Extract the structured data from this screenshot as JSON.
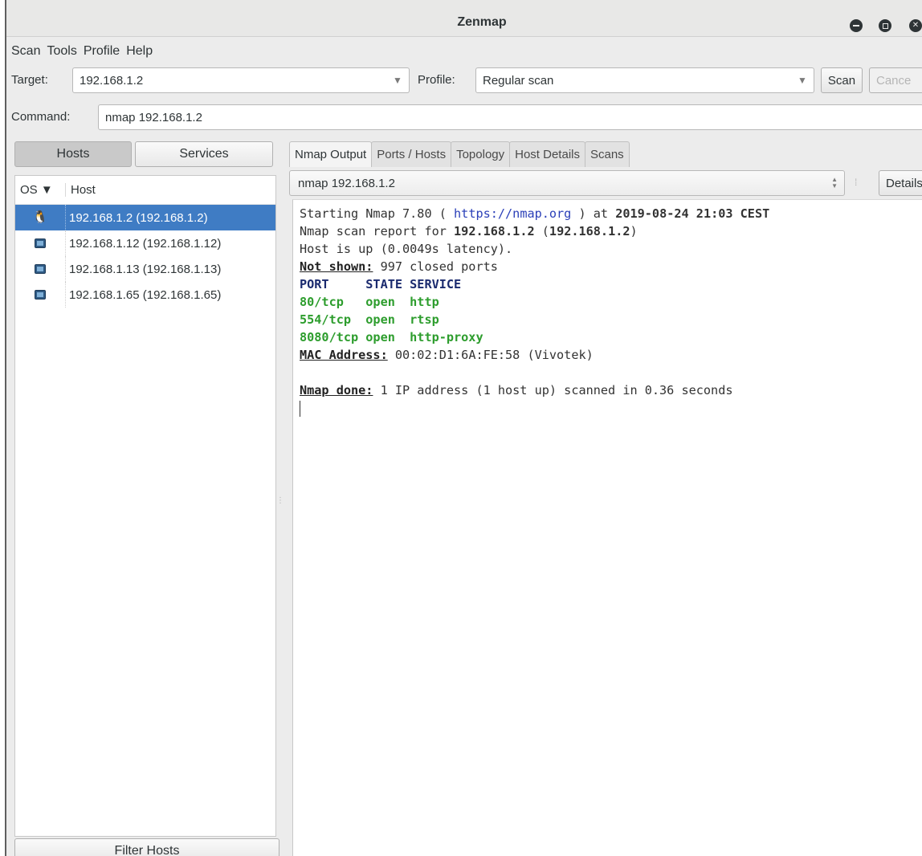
{
  "window": {
    "title": "Zenmap"
  },
  "menu": [
    "Scan",
    "Tools",
    "Profile",
    "Help"
  ],
  "toolbar": {
    "target_label": "Target:",
    "target_value": "192.168.1.2",
    "profile_label": "Profile:",
    "profile_value": "Regular scan",
    "scan_label": "Scan",
    "cancel_label": "Cance"
  },
  "command": {
    "label": "Command:",
    "value": "nmap 192.168.1.2"
  },
  "left_panel": {
    "tabs": [
      "Hosts",
      "Services"
    ],
    "columns": {
      "os": "OS ▼",
      "host": "Host"
    },
    "hosts": [
      {
        "os": "linux",
        "name": "192.168.1.2 (192.168.1.2)",
        "selected": true
      },
      {
        "os": "unknown",
        "name": "192.168.1.12 (192.168.1.12)",
        "selected": false
      },
      {
        "os": "unknown",
        "name": "192.168.1.13 (192.168.1.13)",
        "selected": false
      },
      {
        "os": "unknown",
        "name": "192.168.1.65 (192.168.1.65)",
        "selected": false
      }
    ],
    "filter_label": "Filter Hosts"
  },
  "right_panel": {
    "tabs": [
      "Nmap Output",
      "Ports / Hosts",
      "Topology",
      "Host Details",
      "Scans"
    ],
    "scan_select": "nmap 192.168.1.2",
    "details_label": "Details",
    "output": {
      "l1_a": "Starting Nmap 7.80 ( ",
      "l1_url": "https://nmap.org",
      "l1_b": " ) at ",
      "l1_date": "2019-08-24 21:03 CEST",
      "l2_a": "Nmap scan report for ",
      "l2_b": "192.168.1.2",
      "l2_c": " (",
      "l2_d": "192.168.1.2",
      "l2_e": ")",
      "l3": "Host is up (0.0049s latency).",
      "l4_key": "Not shown:",
      "l4_val": " 997 closed ports",
      "header": "PORT     STATE SERVICE",
      "ports": [
        "80/tcp   open  http",
        "554/tcp  open  rtsp",
        "8080/tcp open  http-proxy"
      ],
      "mac_key": "MAC Address:",
      "mac_val": " 00:02:D1:6A:FE:58 (Vivotek)",
      "done_key": "Nmap done:",
      "done_val": " 1 IP address (1 host up) scanned in 0.36 seconds"
    }
  },
  "colors": {
    "selection": "#3f7cc4",
    "url": "#2a3fb8",
    "open_port": "#2d9d2d",
    "header": "#1a2a6e"
  }
}
